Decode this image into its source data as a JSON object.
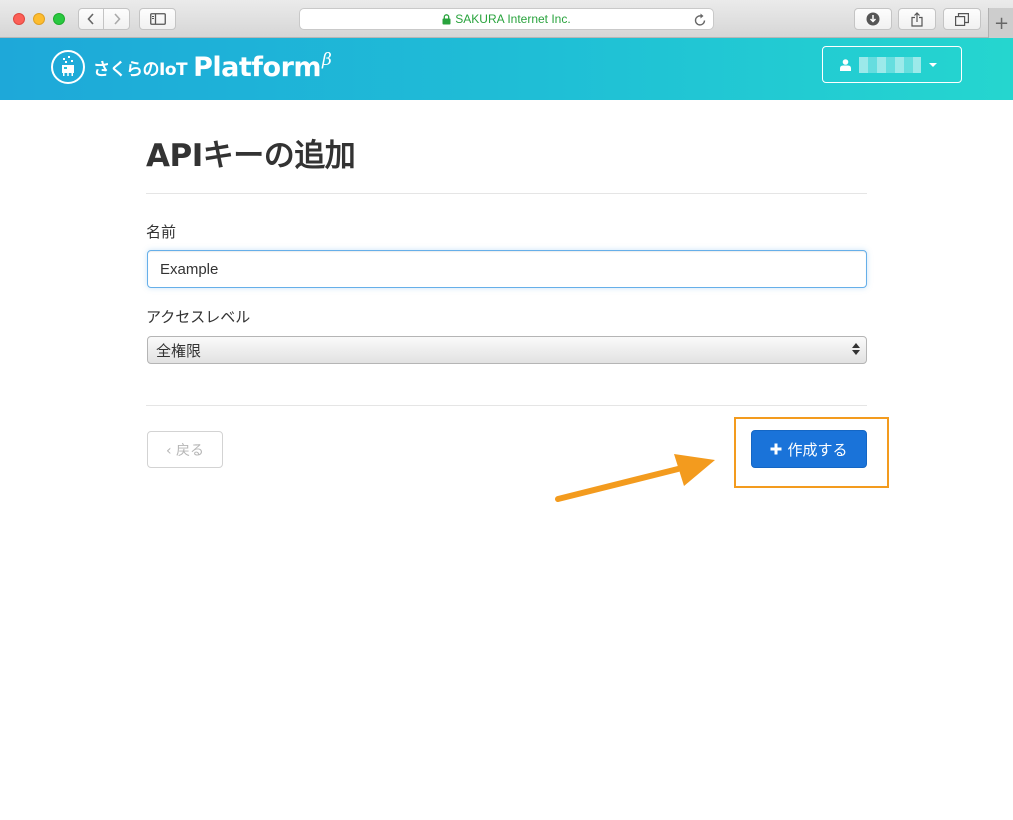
{
  "browser": {
    "url_text": "SAKURA Internet Inc.",
    "new_tab_label": "+"
  },
  "header": {
    "logo_jp": "さくらのIoT",
    "logo_en": "Platform",
    "logo_beta": "β"
  },
  "page": {
    "title": "APIキーの追加",
    "name_label": "名前",
    "name_value": "Example",
    "access_label": "アクセスレベル",
    "access_selected": "全権限",
    "back_label": "‹ 戻る",
    "create_label": "作成する"
  },
  "colors": {
    "header_start": "#1ea8d9",
    "header_end": "#25d6cf",
    "primary_button": "#1a73d9",
    "annotation": "#f39b1e"
  },
  "icons": [
    "back-arrow-icon",
    "forward-arrow-icon",
    "sidebar-icon",
    "lock-icon",
    "reload-icon",
    "download-icon",
    "share-icon",
    "tabs-icon",
    "user-icon",
    "caret-down-icon",
    "plus-icon"
  ]
}
